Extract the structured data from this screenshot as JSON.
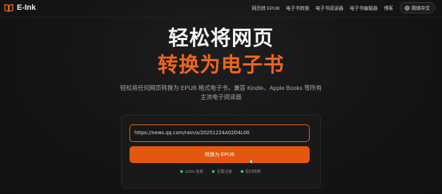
{
  "header": {
    "logo_text": "E-Ink",
    "nav": [
      "网页转 EPUB",
      "电子书转换",
      "电子书阅读器",
      "电子书编辑器",
      "博客"
    ],
    "language": "简体中文"
  },
  "hero": {
    "line1": "轻松将网页",
    "line2": "转换为电子书",
    "subtitle": "轻松将任何网页转换为 EPUB 格式电子书，兼容 Kindle、Apple Books 等所有主流电子阅读器"
  },
  "form": {
    "url_value": "https://news.qq.com/rain/a/20251224A02D4L00",
    "convert_label": "转换为 EPUB"
  },
  "features": [
    "100% 免费",
    "无需注册",
    "实时转换"
  ],
  "colors": {
    "accent": "#e4570f",
    "accent_text": "#f0661a",
    "feature_dot": "#34c26b"
  }
}
